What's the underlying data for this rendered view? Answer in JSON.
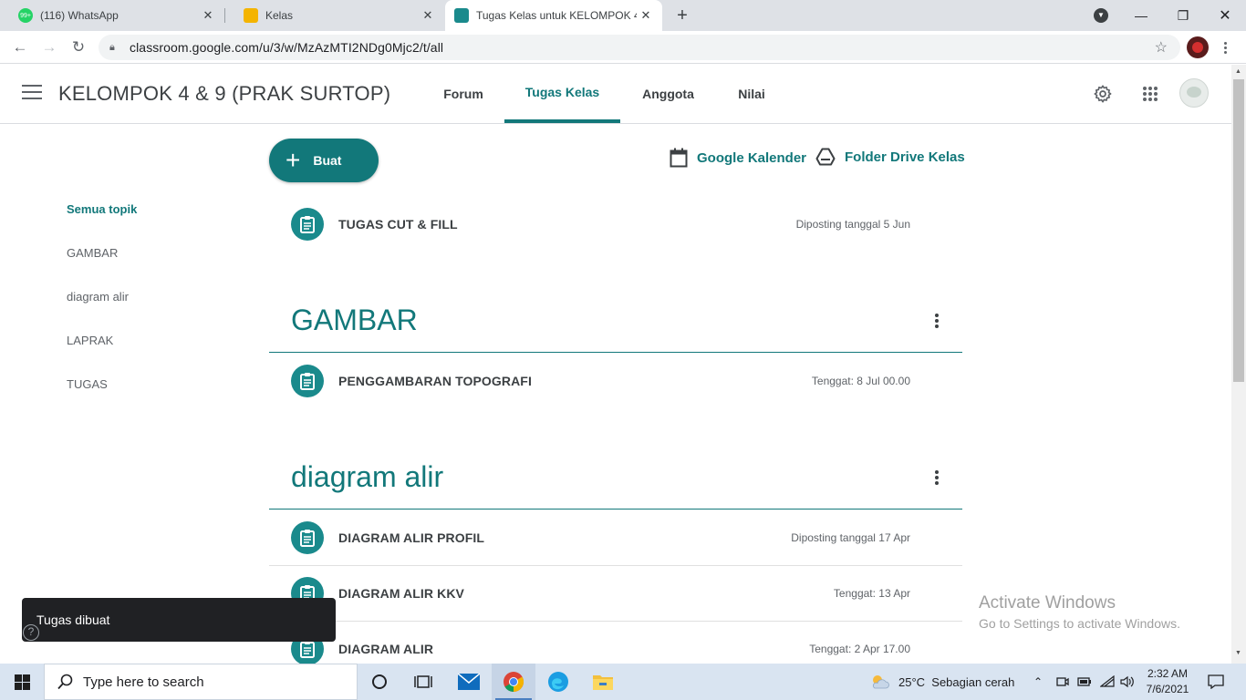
{
  "browser": {
    "tabs": [
      {
        "title": "(116) WhatsApp",
        "favicon_color": "#25d366",
        "badge": "99+"
      },
      {
        "title": "Kelas",
        "favicon_color": "#f4b400"
      },
      {
        "title": "Tugas Kelas untuk KELOMPOK 4",
        "favicon_color": "#1a8a8c",
        "active": true
      }
    ],
    "url": "classroom.google.com/u/3/w/MzAzMTI2NDg0Mjc2/t/all"
  },
  "header": {
    "class_title": "KELOMPOK 4 & 9 (PRAK SURTOP)",
    "tabs": [
      {
        "label": "Forum"
      },
      {
        "label": "Tugas Kelas",
        "active": true
      },
      {
        "label": "Anggota"
      },
      {
        "label": "Nilai"
      }
    ]
  },
  "actions": {
    "create_label": "Buat",
    "calendar_label": "Google Kalender",
    "drive_label": "Folder Drive Kelas"
  },
  "topics": [
    {
      "label": "Semua topik",
      "active": true
    },
    {
      "label": "GAMBAR"
    },
    {
      "label": "diagram alir"
    },
    {
      "label": "LAPRAK"
    },
    {
      "label": "TUGAS"
    }
  ],
  "ungrouped": [
    {
      "title": "TUGAS CUT & FILL",
      "meta": "Diposting tanggal 5 Jun"
    }
  ],
  "sections": [
    {
      "title": "GAMBAR",
      "items": [
        {
          "title": "PENGGAMBARAN TOPOGRAFI",
          "meta": "Tenggat: 8 Jul 00.00"
        }
      ]
    },
    {
      "title": "diagram alir",
      "items": [
        {
          "title": "DIAGRAM ALIR PROFIL",
          "meta": "Diposting tanggal 17 Apr"
        },
        {
          "title": "DIAGRAM ALIR KKV",
          "meta": "Tenggat: 13 Apr"
        },
        {
          "title": "DIAGRAM ALIR",
          "meta": "Tenggat: 2 Apr 17.00"
        }
      ]
    }
  ],
  "snackbar": {
    "text": "Tugas dibuat"
  },
  "watermark": {
    "line1": "Activate Windows",
    "line2": "Go to Settings to activate Windows."
  },
  "taskbar": {
    "search_placeholder": "Type here to search",
    "weather": "25°C  Sebagian cerah",
    "time": "2:32 AM",
    "date": "7/6/2021"
  },
  "colors": {
    "accent": "#12787a",
    "icon_bg": "#1a8a8c"
  }
}
